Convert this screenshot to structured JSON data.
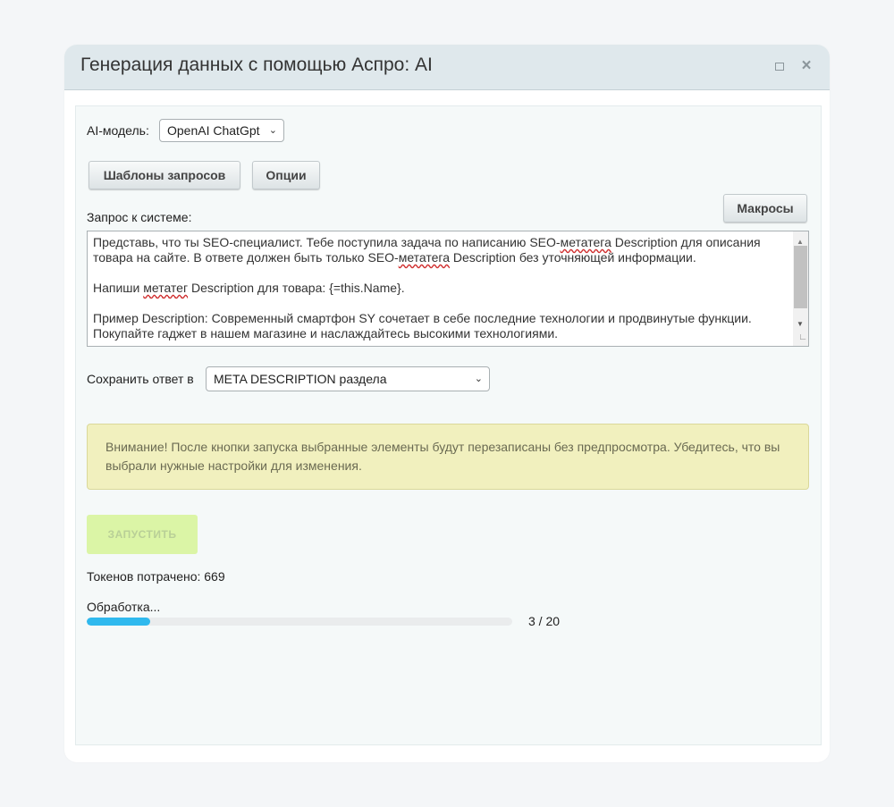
{
  "dialog": {
    "title": "Генерация данных с помощью Аспро: AI",
    "maximize_icon": "maximize-icon",
    "close_icon": "close-icon",
    "close_glyph": "×"
  },
  "model": {
    "label": "AI-модель:",
    "selected": "OpenAI ChatGpt"
  },
  "buttons": {
    "templates": "Шаблоны запросов",
    "options": "Опции",
    "macros": "Макросы",
    "run": "ЗАПУСТИТЬ"
  },
  "request": {
    "label": "Запрос к системе:",
    "paragraphs": {
      "p1a": "Представь, что ты SEO-специалист. Тебе поступила задача по написанию SEO-",
      "p1b": "метатега",
      "p1c": " Description для описания товара на сайте. В ответе должен быть только SEO-",
      "p1d": "метатега",
      "p1e": " Description без уточняющей информации.",
      "p2a": "Напиши ",
      "p2b": "метатег",
      "p2c": " Description для товара: {=this.Name}.",
      "p3": "Пример Description: Современный смартфон SY сочетает в себе последние технологии и продвинутые функции. Покупайте гаджет в нашем магазине и наслаждайтесь высокими технологиями."
    }
  },
  "save": {
    "label": "Сохранить ответ в",
    "selected": "META DESCRIPTION раздела"
  },
  "alert": {
    "text": "Внимание! После кнопки запуска выбранные элементы будут перезаписаны без предпросмотра. Убедитесь, что вы выбрали нужные настройки для изменения."
  },
  "tokens": {
    "text": "Токенов потрачено: 669"
  },
  "progress": {
    "label": "Обработка...",
    "done": 3,
    "total": 20,
    "count_text": "3 / 20",
    "fraction": 0.15
  },
  "colors": {
    "accent": "#2fb9ee",
    "alert_bg": "#f1f0be",
    "run_disabled": "#dbf5a6"
  }
}
